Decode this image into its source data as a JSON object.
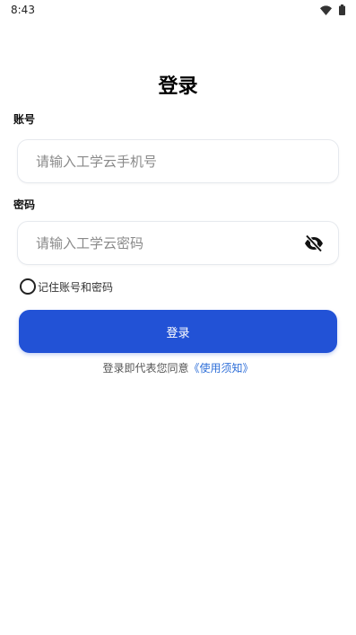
{
  "status_bar": {
    "time": "8:43",
    "icons": [
      "wifi-icon",
      "battery-icon"
    ]
  },
  "title": "登录",
  "account": {
    "label": "账号",
    "placeholder": "请输入工学云手机号",
    "value": ""
  },
  "password": {
    "label": "密码",
    "placeholder": "请输入工学云密码",
    "value": "",
    "toggle_icon": "eye-off-icon"
  },
  "remember": {
    "label": "记住账号和密码",
    "checked": false
  },
  "login_button": {
    "label": "登录",
    "color": "#2252d6"
  },
  "agreement": {
    "text": "登录即代表您同意",
    "link": "《使用须知》",
    "link_color": "#2f6fd8"
  }
}
